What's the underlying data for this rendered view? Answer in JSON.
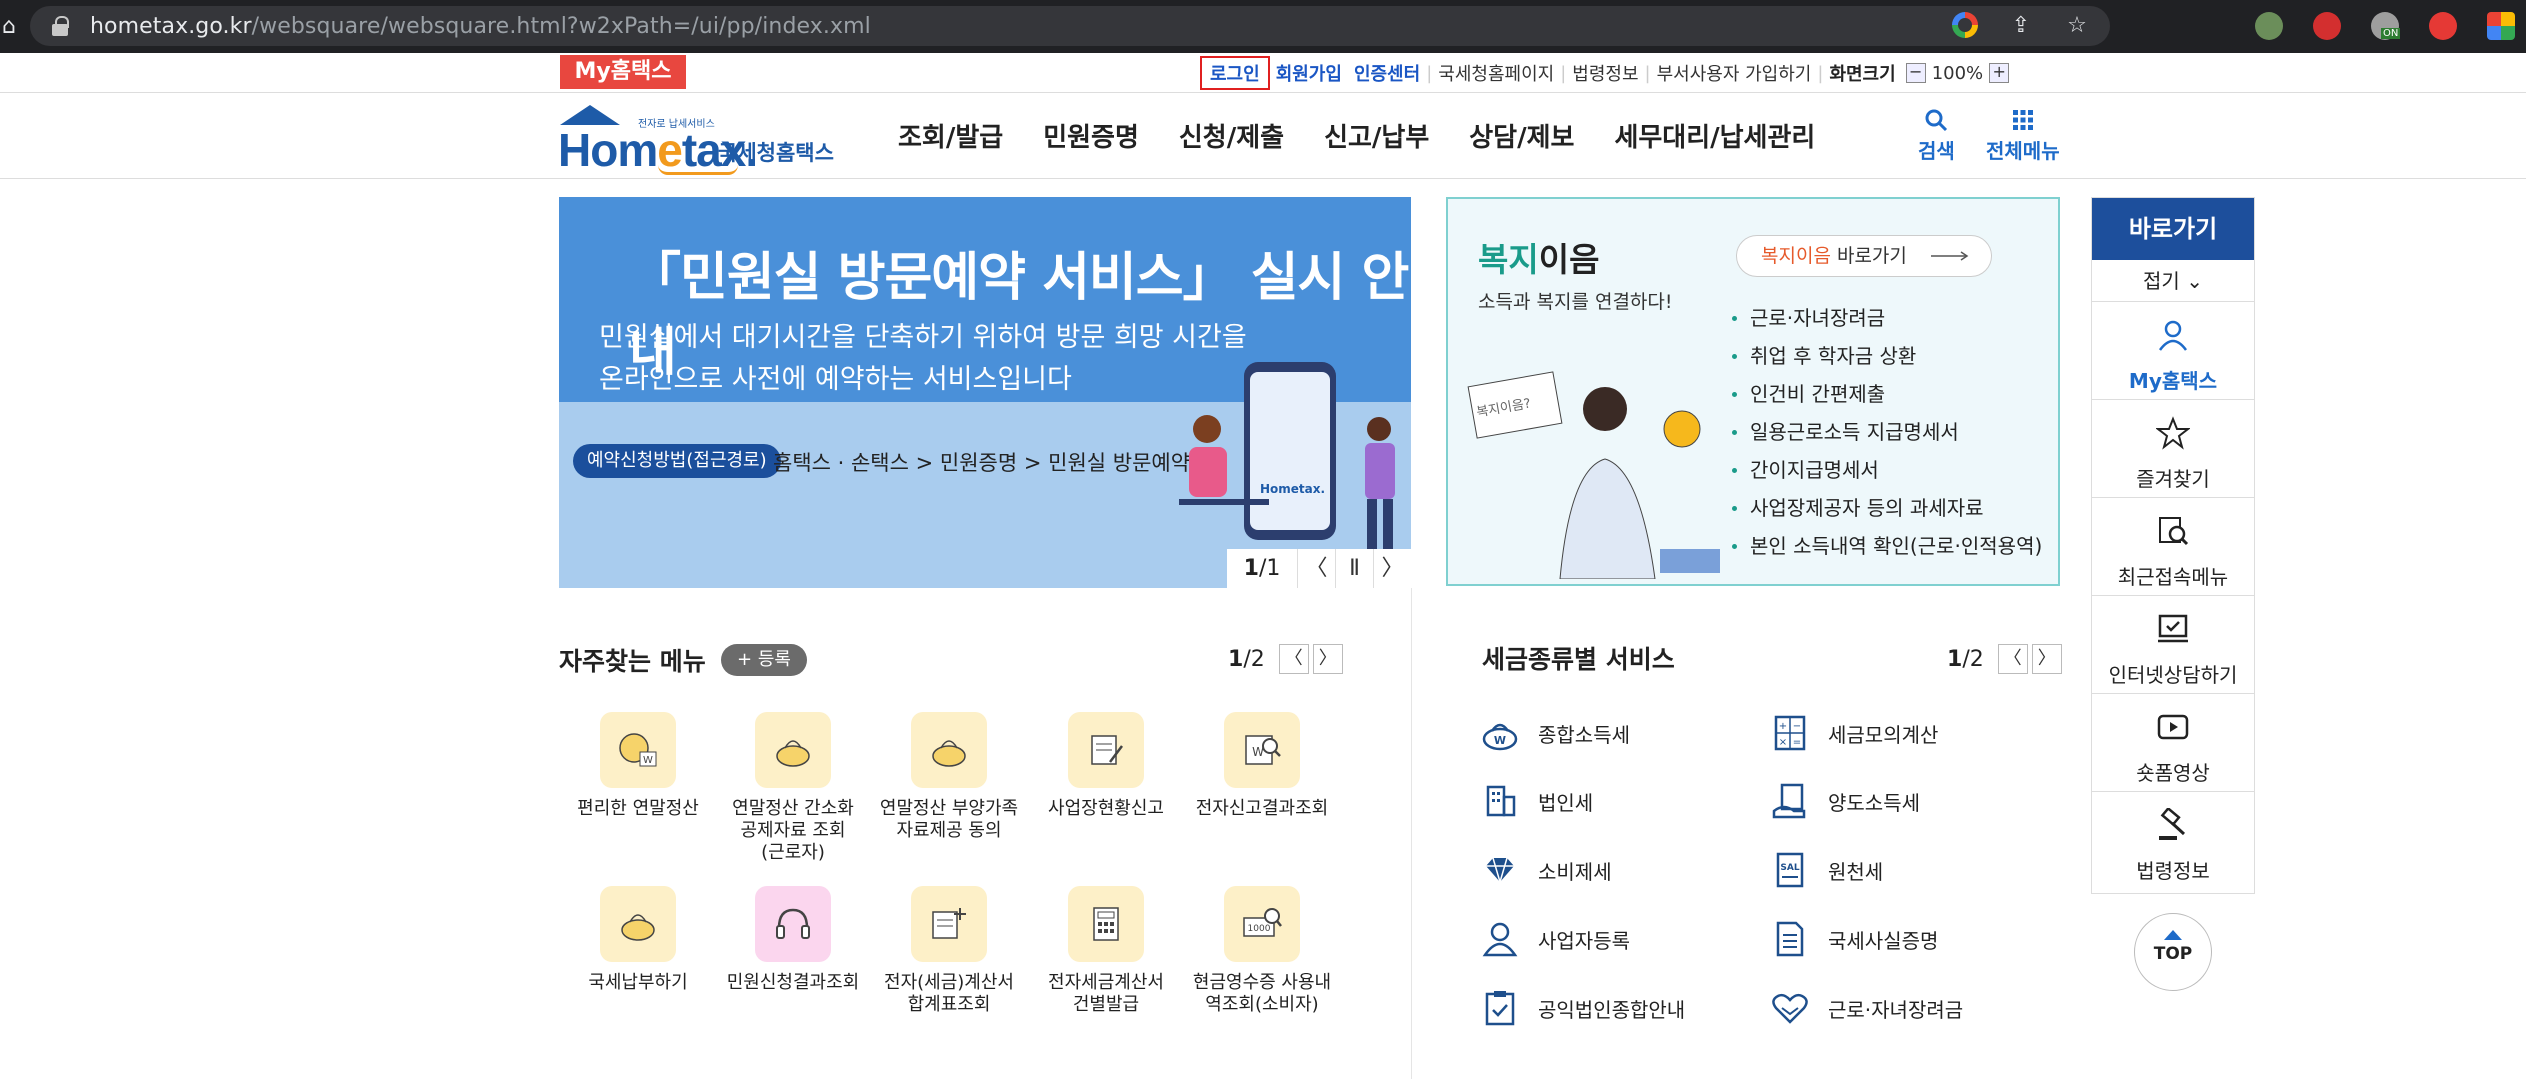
{
  "browser": {
    "url_host": "hometax.go.kr",
    "url_path": "/websquare/websquare.html?w2xPath=/ui/pp/index.xml",
    "ext_badge": "ON"
  },
  "util": {
    "my_tag": "My홈택스",
    "login": "로그인",
    "signup": "회원가입",
    "cert": "인증센터",
    "nts_page": "국세청홈페이지",
    "law": "법령정보",
    "dept_join": "부서사용자 가입하기",
    "screen_size": "화면크기",
    "zoom_minus": "−",
    "zoom_value": "100%",
    "zoom_plus": "+"
  },
  "header": {
    "logo_small": "전자로 납세서비스",
    "logo_main_a": "Hom",
    "logo_main_b": "e",
    "logo_main_c": "tax.",
    "logo_sub": "국세청홈택스",
    "nav": [
      "조회/발급",
      "민원증명",
      "신청/제출",
      "신고/납부",
      "상담/제보",
      "세무대리/납세관리"
    ],
    "search": "검색",
    "all_menu": "전체메뉴"
  },
  "banner": {
    "title": "「민원실 방문예약 서비스」 실시 안내",
    "sub1": "민원실에서 대기시간을 단축하기 위하여 방문 희망 시간을",
    "sub2": "온라인으로 사전에 예약하는 서비스입니다",
    "pill": "예약신청방법(접근경로)",
    "path": "홈택스 · 손택스 > 민원증명 > 민원실 방문예약",
    "page_cur": "1",
    "page_total": "/1",
    "prev": "〈",
    "pause": "Ⅱ",
    "next": "〉",
    "phone_label": "Hometax."
  },
  "welfare": {
    "title_a": "복지",
    "title_b": "이음",
    "desc": "소득과 복지를 연결하다!",
    "go_a": "복지이음",
    "go_b": " 바로가기",
    "bubble": "복지이음?",
    "items": [
      "근로·자녀장려금",
      "취업 후 학자금 상환",
      "인건비 간편제출",
      "일용근로소득 지급명세서",
      "간이지급명세서",
      "사업장제공자 등의 과세자료",
      "본인 소득내역 확인(근로·인적용역)"
    ]
  },
  "quick": {
    "head": "바로가기",
    "fold": "접기 ⌄",
    "items": [
      "My홈택스",
      "즐겨찾기",
      "최근접속메뉴",
      "인터넷상담하기",
      "숏폼영상",
      "법령정보"
    ],
    "top": "TOP"
  },
  "favorites": {
    "title": "자주찾는 메뉴",
    "register": "+ 등록",
    "page_cur": "1",
    "page_total": "/2",
    "prev": "〈",
    "next": "〉",
    "items": [
      [
        "편리한 연말정산"
      ],
      [
        "연말정산 간소화",
        "공제자료 조회",
        "(근로자)"
      ],
      [
        "연말정산 부양가족",
        "자료제공 동의"
      ],
      [
        "사업장현황신고"
      ],
      [
        "전자신고결과조회"
      ],
      [
        "국세납부하기"
      ],
      [
        "민원신청결과조회"
      ],
      [
        "전자(세금)계산서",
        "합계표조회"
      ],
      [
        "전자세금계산서",
        "건별발급"
      ],
      [
        "현금영수증 사용내",
        "역조회(소비자)"
      ]
    ],
    "icon_w": "W",
    "icon_1000": "1000"
  },
  "taxsvc": {
    "title": "세금종류별 서비스",
    "page_cur": "1",
    "page_total": "/2",
    "prev": "〈",
    "next": "〉",
    "left": [
      "종합소득세",
      "법인세",
      "소비제세",
      "사업자등록",
      "공익법인종합안내"
    ],
    "right": [
      "세금모의계산",
      "양도소득세",
      "원천세",
      "국세사실증명",
      "근로·자녀장려금"
    ],
    "icon_w": "W",
    "icon_sal": "SAL"
  }
}
